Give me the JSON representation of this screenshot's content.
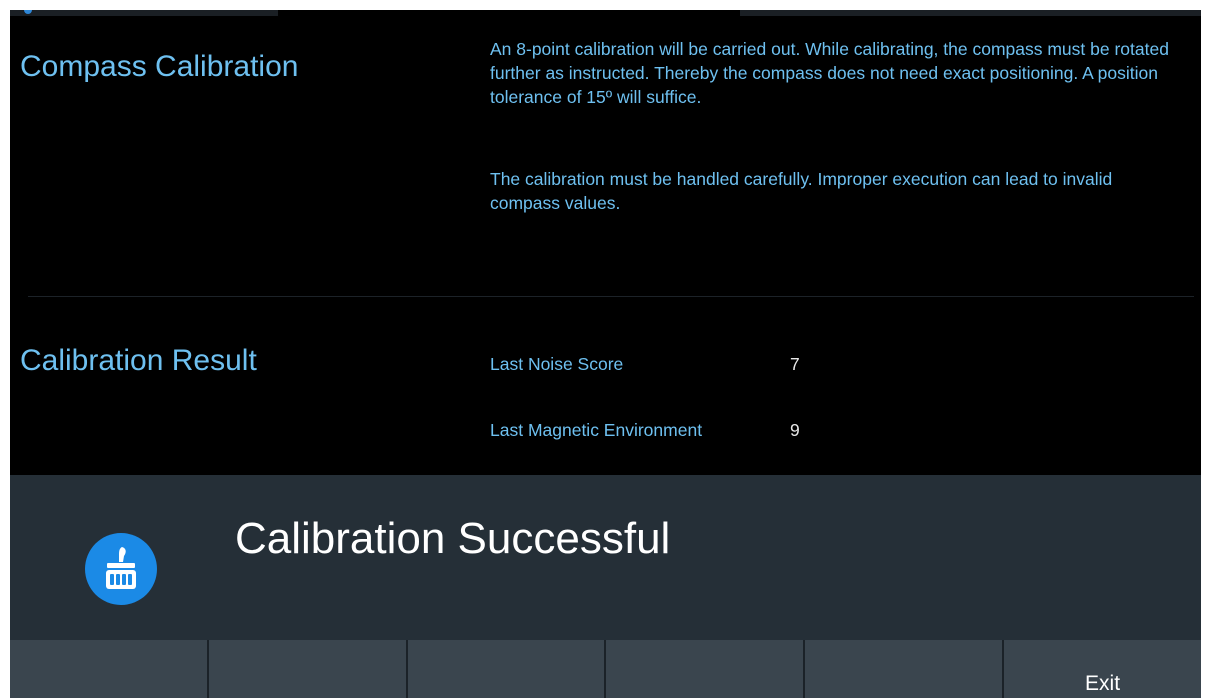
{
  "compass_calibration": {
    "title": "Compass Calibration",
    "paragraph_1": "An 8-point calibration will be carried out. While calibrating, the compass must be rotated further as instructed. Thereby the compass does not need exact positioning. A position tolerance of 15º will suffice.",
    "paragraph_2": "The calibration must be handled carefully. Improper execution can lead to invalid compass values."
  },
  "calibration_result": {
    "title": "Calibration Result",
    "rows": [
      {
        "label": "Last Noise Score",
        "value": "7"
      },
      {
        "label": "Last Magnetic Environment",
        "value": "9"
      }
    ]
  },
  "dialog": {
    "message": "Calibration Successful",
    "icon": "brush-icon"
  },
  "softkeys": [
    "",
    "",
    "",
    "",
    "",
    "Exit"
  ],
  "colors": {
    "background": "#000000",
    "accent_text": "#6ec0f0",
    "dialog_bg": "#252f37",
    "icon_bg": "#1b8ae6",
    "softkey_bg": "#3a454e"
  }
}
